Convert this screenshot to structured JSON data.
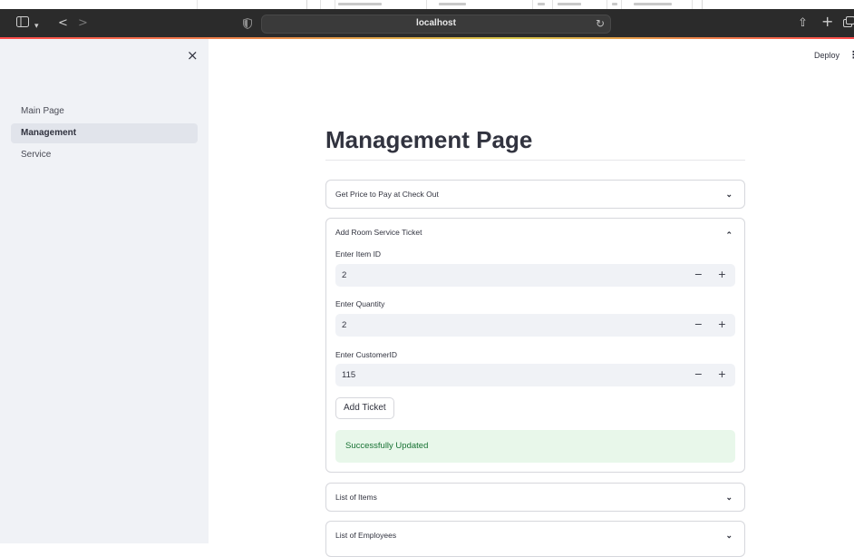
{
  "browser": {
    "url": "localhost",
    "back": "<",
    "forward": ">",
    "share": "⇧",
    "new_tab": "+",
    "reload": "↻"
  },
  "sidebar": {
    "close": "×",
    "items": [
      {
        "label": "Main Page"
      },
      {
        "label": "Management"
      },
      {
        "label": "Service"
      }
    ]
  },
  "header": {
    "deploy": "Deploy",
    "menu": "⋮"
  },
  "page": {
    "title": "Management Page"
  },
  "expanders": {
    "price": {
      "label": "Get Price to Pay at Check Out",
      "chevron": "⌄"
    },
    "ticket": {
      "label": "Add Room Service Ticket",
      "chevron": "⌃",
      "item_id": {
        "label": "Enter Item ID",
        "value": "2"
      },
      "quantity": {
        "label": "Enter Quantity",
        "value": "2"
      },
      "customer": {
        "label": "Enter CustomerID",
        "value": "115"
      },
      "button": "Add Ticket",
      "success": "Successfully Updated"
    },
    "items": {
      "label": "List of Items",
      "chevron": "⌄"
    },
    "employees": {
      "label": "List of Employees",
      "chevron": "⌄"
    }
  },
  "stepper": {
    "minus": "−",
    "plus": "+"
  }
}
